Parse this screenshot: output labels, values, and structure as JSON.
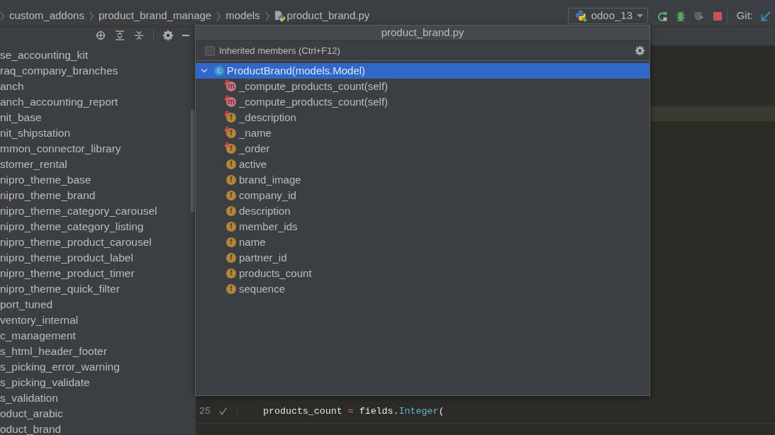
{
  "breadcrumbs": [
    {
      "label": "custom_addons",
      "kind": "folder"
    },
    {
      "label": "product_brand_manage",
      "kind": "folder"
    },
    {
      "label": "models",
      "kind": "folder"
    },
    {
      "label": "product_brand.py",
      "kind": "python_file"
    }
  ],
  "run_toolbar": {
    "configuration": "odoo_13",
    "git_label": "Git:"
  },
  "project_panel": {
    "items": [
      "se_accounting_kit",
      "raq_company_branches",
      "anch",
      "anch_accounting_report",
      "nit_base",
      "nit_shipstation",
      "mmon_connector_library",
      "stomer_rental",
      "nipro_theme_base",
      "nipro_theme_brand",
      "nipro_theme_category_carousel",
      "nipro_theme_category_listing",
      "nipro_theme_product_carousel",
      "nipro_theme_product_label",
      "nipro_theme_product_timer",
      "nipro_theme_quick_filter",
      "port_tuned",
      "ventory_internal",
      "c_management",
      "s_html_header_footer",
      "s_picking_error_warning",
      "s_picking_validate",
      "s_validation",
      "oduct_arabic",
      "oduct_brand"
    ]
  },
  "editor": {
    "current_line_highlighted": true,
    "lines": [
      {
        "number": "25",
        "check": true,
        "tokens": [
          {
            "text": "products_count ",
            "kind": "plain"
          },
          {
            "text": "=",
            "kind": "operator"
          },
          {
            "text": " fields.",
            "kind": "plain"
          },
          {
            "text": "Integer",
            "kind": "class"
          },
          {
            "text": "(",
            "kind": "plain"
          }
        ]
      }
    ]
  },
  "structure_popup": {
    "title": "product_brand.py",
    "inherited_members": {
      "label": "Inherited members (Ctrl+F12)",
      "checked": false
    },
    "root": {
      "name": "ProductBrand(models.Model)",
      "kind": "class",
      "badge": "c",
      "expanded": true,
      "selected": true,
      "children": [
        {
          "name": "_compute_products_count(self)",
          "kind": "method",
          "badge": "m",
          "private": true,
          "selected": false
        },
        {
          "name": "_compute_products_count(self)",
          "kind": "method",
          "badge": "m",
          "private": true,
          "selected": false
        },
        {
          "name": "_description",
          "kind": "field",
          "badge": "f",
          "private": true,
          "selected": false
        },
        {
          "name": "_name",
          "kind": "field",
          "badge": "f",
          "private": true,
          "selected": false
        },
        {
          "name": "_order",
          "kind": "field",
          "badge": "f",
          "private": true,
          "selected": false
        },
        {
          "name": "active",
          "kind": "field",
          "badge": "f",
          "private": false,
          "selected": false
        },
        {
          "name": "brand_image",
          "kind": "field",
          "badge": "f",
          "private": false,
          "selected": false
        },
        {
          "name": "company_id",
          "kind": "field",
          "badge": "f",
          "private": false,
          "selected": false
        },
        {
          "name": "description",
          "kind": "field",
          "badge": "f",
          "private": false,
          "selected": false
        },
        {
          "name": "member_ids",
          "kind": "field",
          "badge": "f",
          "private": false,
          "selected": false
        },
        {
          "name": "name",
          "kind": "field",
          "badge": "f",
          "private": false,
          "selected": false
        },
        {
          "name": "partner_id",
          "kind": "field",
          "badge": "f",
          "private": false,
          "selected": false
        },
        {
          "name": "products_count",
          "kind": "field",
          "badge": "f",
          "private": false,
          "selected": false
        },
        {
          "name": "sequence",
          "kind": "field",
          "badge": "f",
          "private": false,
          "selected": false
        }
      ]
    }
  }
}
